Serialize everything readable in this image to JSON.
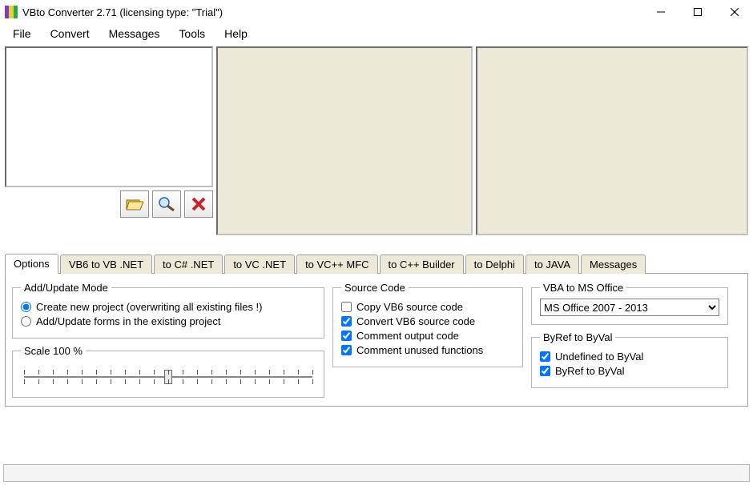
{
  "window": {
    "title": "VBto Converter 2.71 (licensing type: \"Trial\")"
  },
  "menu": {
    "file": "File",
    "convert": "Convert",
    "messages": "Messages",
    "tools": "Tools",
    "help": "Help"
  },
  "tabs": {
    "options": "Options",
    "vb6net": "VB6 to VB .NET",
    "csnet": "to C# .NET",
    "vcnet": "to VC .NET",
    "vcmfc": "to VC++ MFC",
    "cppbuilder": "to C++ Builder",
    "delphi": "to Delphi",
    "java": "to JAVA",
    "messages": "Messages"
  },
  "groups": {
    "addupdate": {
      "legend": "Add/Update Mode",
      "create": "Create new project (overwriting all existing files !)",
      "update": "Add/Update forms in the existing project"
    },
    "scale": {
      "legend": "Scale 100 %"
    },
    "source": {
      "legend": "Source Code",
      "copy": "Copy VB6 source code",
      "convert": "Convert VB6 source code",
      "commentout": "Comment output code",
      "commentunused": "Comment unused functions"
    },
    "vba": {
      "legend": "VBA to MS Office",
      "selected": "MS Office 2007 - 2013"
    },
    "byref": {
      "legend": "ByRef to ByVal",
      "undef": "Undefined to ByVal",
      "byref": "ByRef to ByVal"
    }
  },
  "icons": {
    "open": "open-folder-icon",
    "find": "magnifier-icon",
    "delete": "delete-x-icon"
  }
}
